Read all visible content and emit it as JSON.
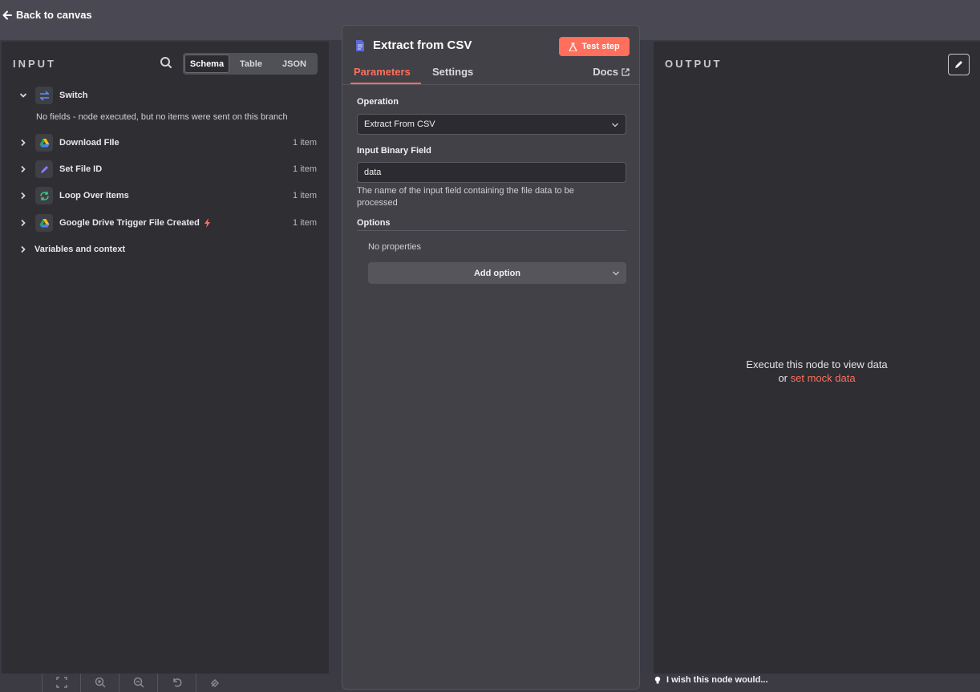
{
  "topbar": {
    "back_label": "Back to canvas"
  },
  "input_panel": {
    "heading": "INPUT",
    "view_modes": [
      "Schema",
      "Table",
      "JSON"
    ],
    "active_mode": "Schema",
    "switch_node": {
      "label": "Switch",
      "message": "No fields - node executed, but no items were sent on this branch"
    },
    "nodes": [
      {
        "label": "Download FIle",
        "count": "1 item",
        "icon": "google-drive-icon"
      },
      {
        "label": "Set File ID",
        "count": "1 item",
        "icon": "pencil-icon"
      },
      {
        "label": "Loop Over Items",
        "count": "1 item",
        "icon": "loop-icon"
      },
      {
        "label": "Google Drive Trigger File Created",
        "count": "1 item",
        "icon": "google-drive-icon"
      }
    ],
    "variables_label": "Variables and context"
  },
  "node_panel": {
    "title": "Extract from CSV",
    "test_button": "Test step",
    "tabs": [
      "Parameters",
      "Settings"
    ],
    "docs_label": "Docs",
    "operation_label": "Operation",
    "operation_value": "Extract From CSV",
    "binary_field_label": "Input Binary Field",
    "binary_field_value": "data",
    "binary_field_hint": "The name of the input field containing the file data to be processed",
    "options_label": "Options",
    "no_properties": "No properties",
    "add_option": "Add option"
  },
  "output_panel": {
    "heading": "OUTPUT",
    "empty_line1": "Execute this node to view data",
    "empty_or": "or",
    "mock_link": "set mock data"
  },
  "footer": {
    "wish": "I wish this node would..."
  },
  "colors": {
    "accent": "#ff6f5c",
    "panel": "#2e2e33",
    "center": "#414147"
  }
}
